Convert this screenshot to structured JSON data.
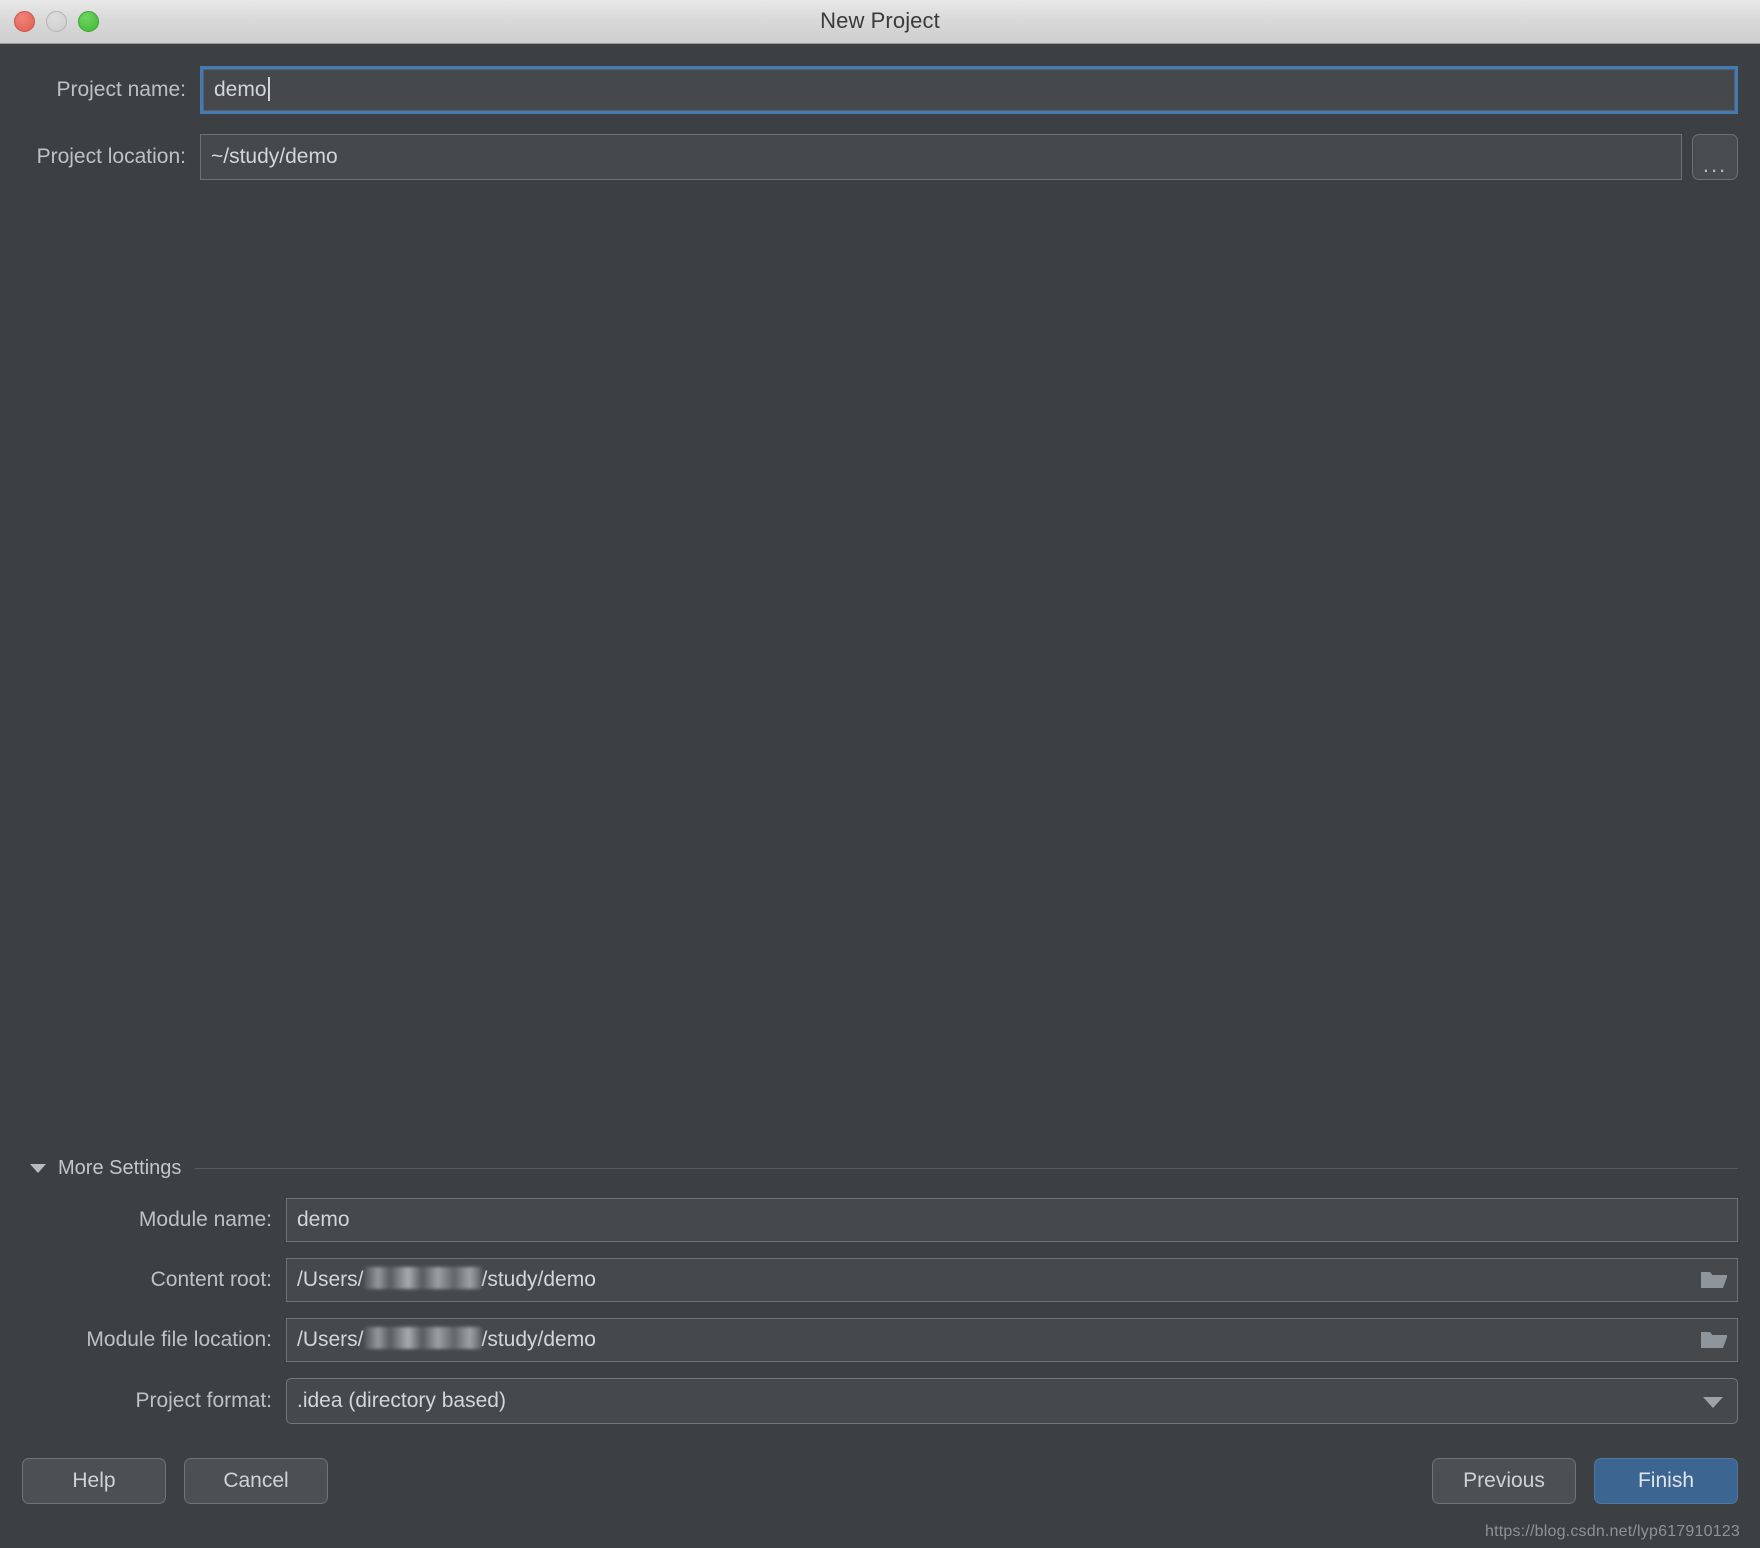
{
  "window": {
    "title": "New Project",
    "traffic_lights": [
      "close",
      "minimize",
      "zoom"
    ]
  },
  "form": {
    "project_name": {
      "label": "Project name:",
      "value": "demo",
      "focused": true
    },
    "project_location": {
      "label": "Project location:",
      "value": "~/study/demo",
      "browse_label": "..."
    }
  },
  "more_settings": {
    "title": "More Settings",
    "expanded": true,
    "rows": [
      {
        "label": "Module name:",
        "value": "demo",
        "kind": "text"
      },
      {
        "label": "Content root:",
        "value_prefix": "/Users/",
        "value_suffix": "/study/demo",
        "redacted": true,
        "kind": "text-browse",
        "icon": "folder-icon"
      },
      {
        "label": "Module file location:",
        "value_prefix": "/Users/",
        "value_suffix": "/study/demo",
        "redacted": true,
        "kind": "text-browse",
        "icon": "folder-icon"
      },
      {
        "label": "Project format:",
        "value": ".idea (directory based)",
        "kind": "combo",
        "icon": "chevron-down-icon"
      }
    ]
  },
  "footer": {
    "help_label": "Help",
    "cancel_label": "Cancel",
    "previous_label": "Previous",
    "finish_label": "Finish",
    "watermark": "https://blog.csdn.net/lyp617910123"
  },
  "colors": {
    "window_bg": "#3c4043",
    "field_bg": "#45494c",
    "field_border": "#6c7175",
    "text": "#d2d6d9",
    "label": "#bdc1c4",
    "focus_ring": "#437cb5",
    "primary_button": "#3d6592",
    "titlebar_text": "#3b3b3b"
  }
}
